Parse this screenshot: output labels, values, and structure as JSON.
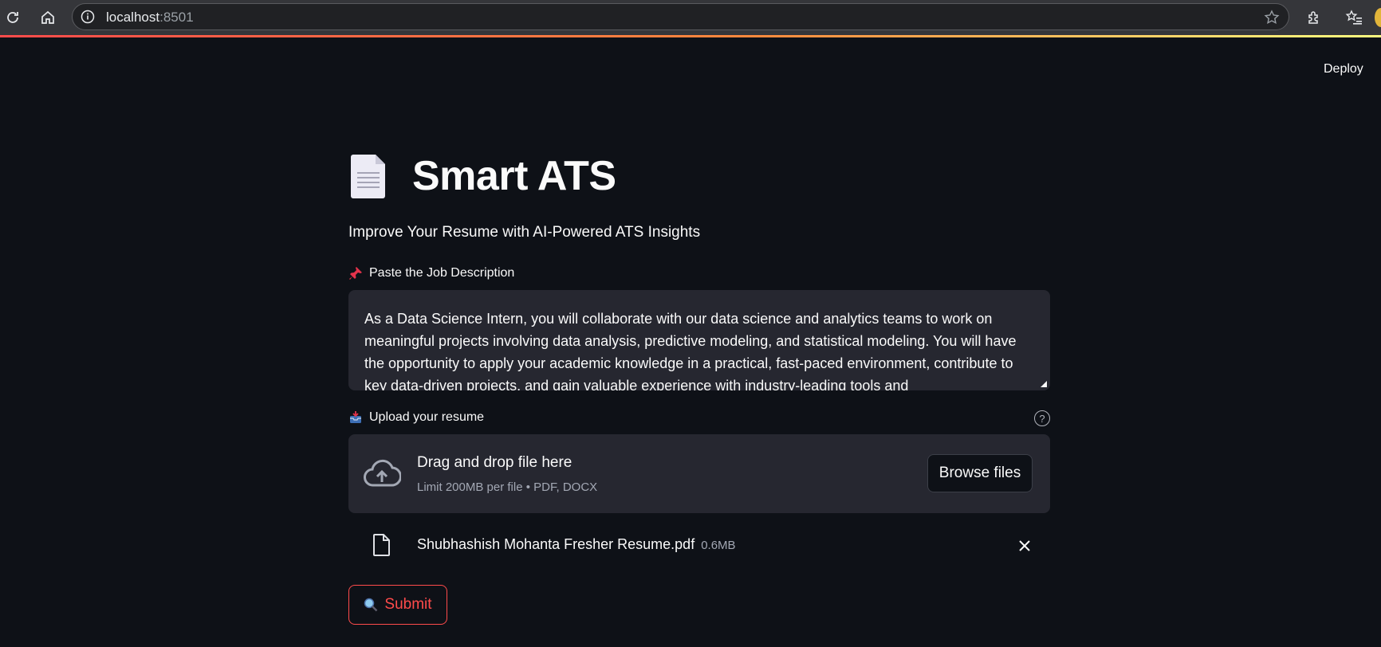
{
  "browser": {
    "url_host": "localhost",
    "url_port": ":8501"
  },
  "header": {
    "deploy_label": "Deploy"
  },
  "app": {
    "title": "Smart ATS",
    "subtitle": "Improve Your Resume with AI-Powered ATS Insights"
  },
  "job_description": {
    "label": "Paste the Job Description",
    "label_icon": "pushpin-icon",
    "value": "As a Data Science Intern, you will collaborate with our data science and analytics teams to work on meaningful projects involving data analysis, predictive modeling, and statistical modeling. You will have the opportunity to apply your academic knowledge in a practical, fast-paced environment, contribute to key data-driven projects, and gain valuable experience with industry-leading tools and"
  },
  "uploader": {
    "label": "Upload your resume",
    "label_icon": "inbox-tray-icon",
    "dropzone_title": "Drag and drop file here",
    "dropzone_limit": "Limit 200MB per file • PDF, DOCX",
    "browse_label": "Browse files",
    "file": {
      "name": "Shubhashish Mohanta Fresher Resume.pdf",
      "size": "0.6MB"
    }
  },
  "submit": {
    "label": "Submit",
    "icon": "magnifier-icon"
  },
  "colors": {
    "background": "#0e1117",
    "input_bg": "#262730",
    "accent": "#ff4b4b",
    "text": "#fafafa"
  }
}
